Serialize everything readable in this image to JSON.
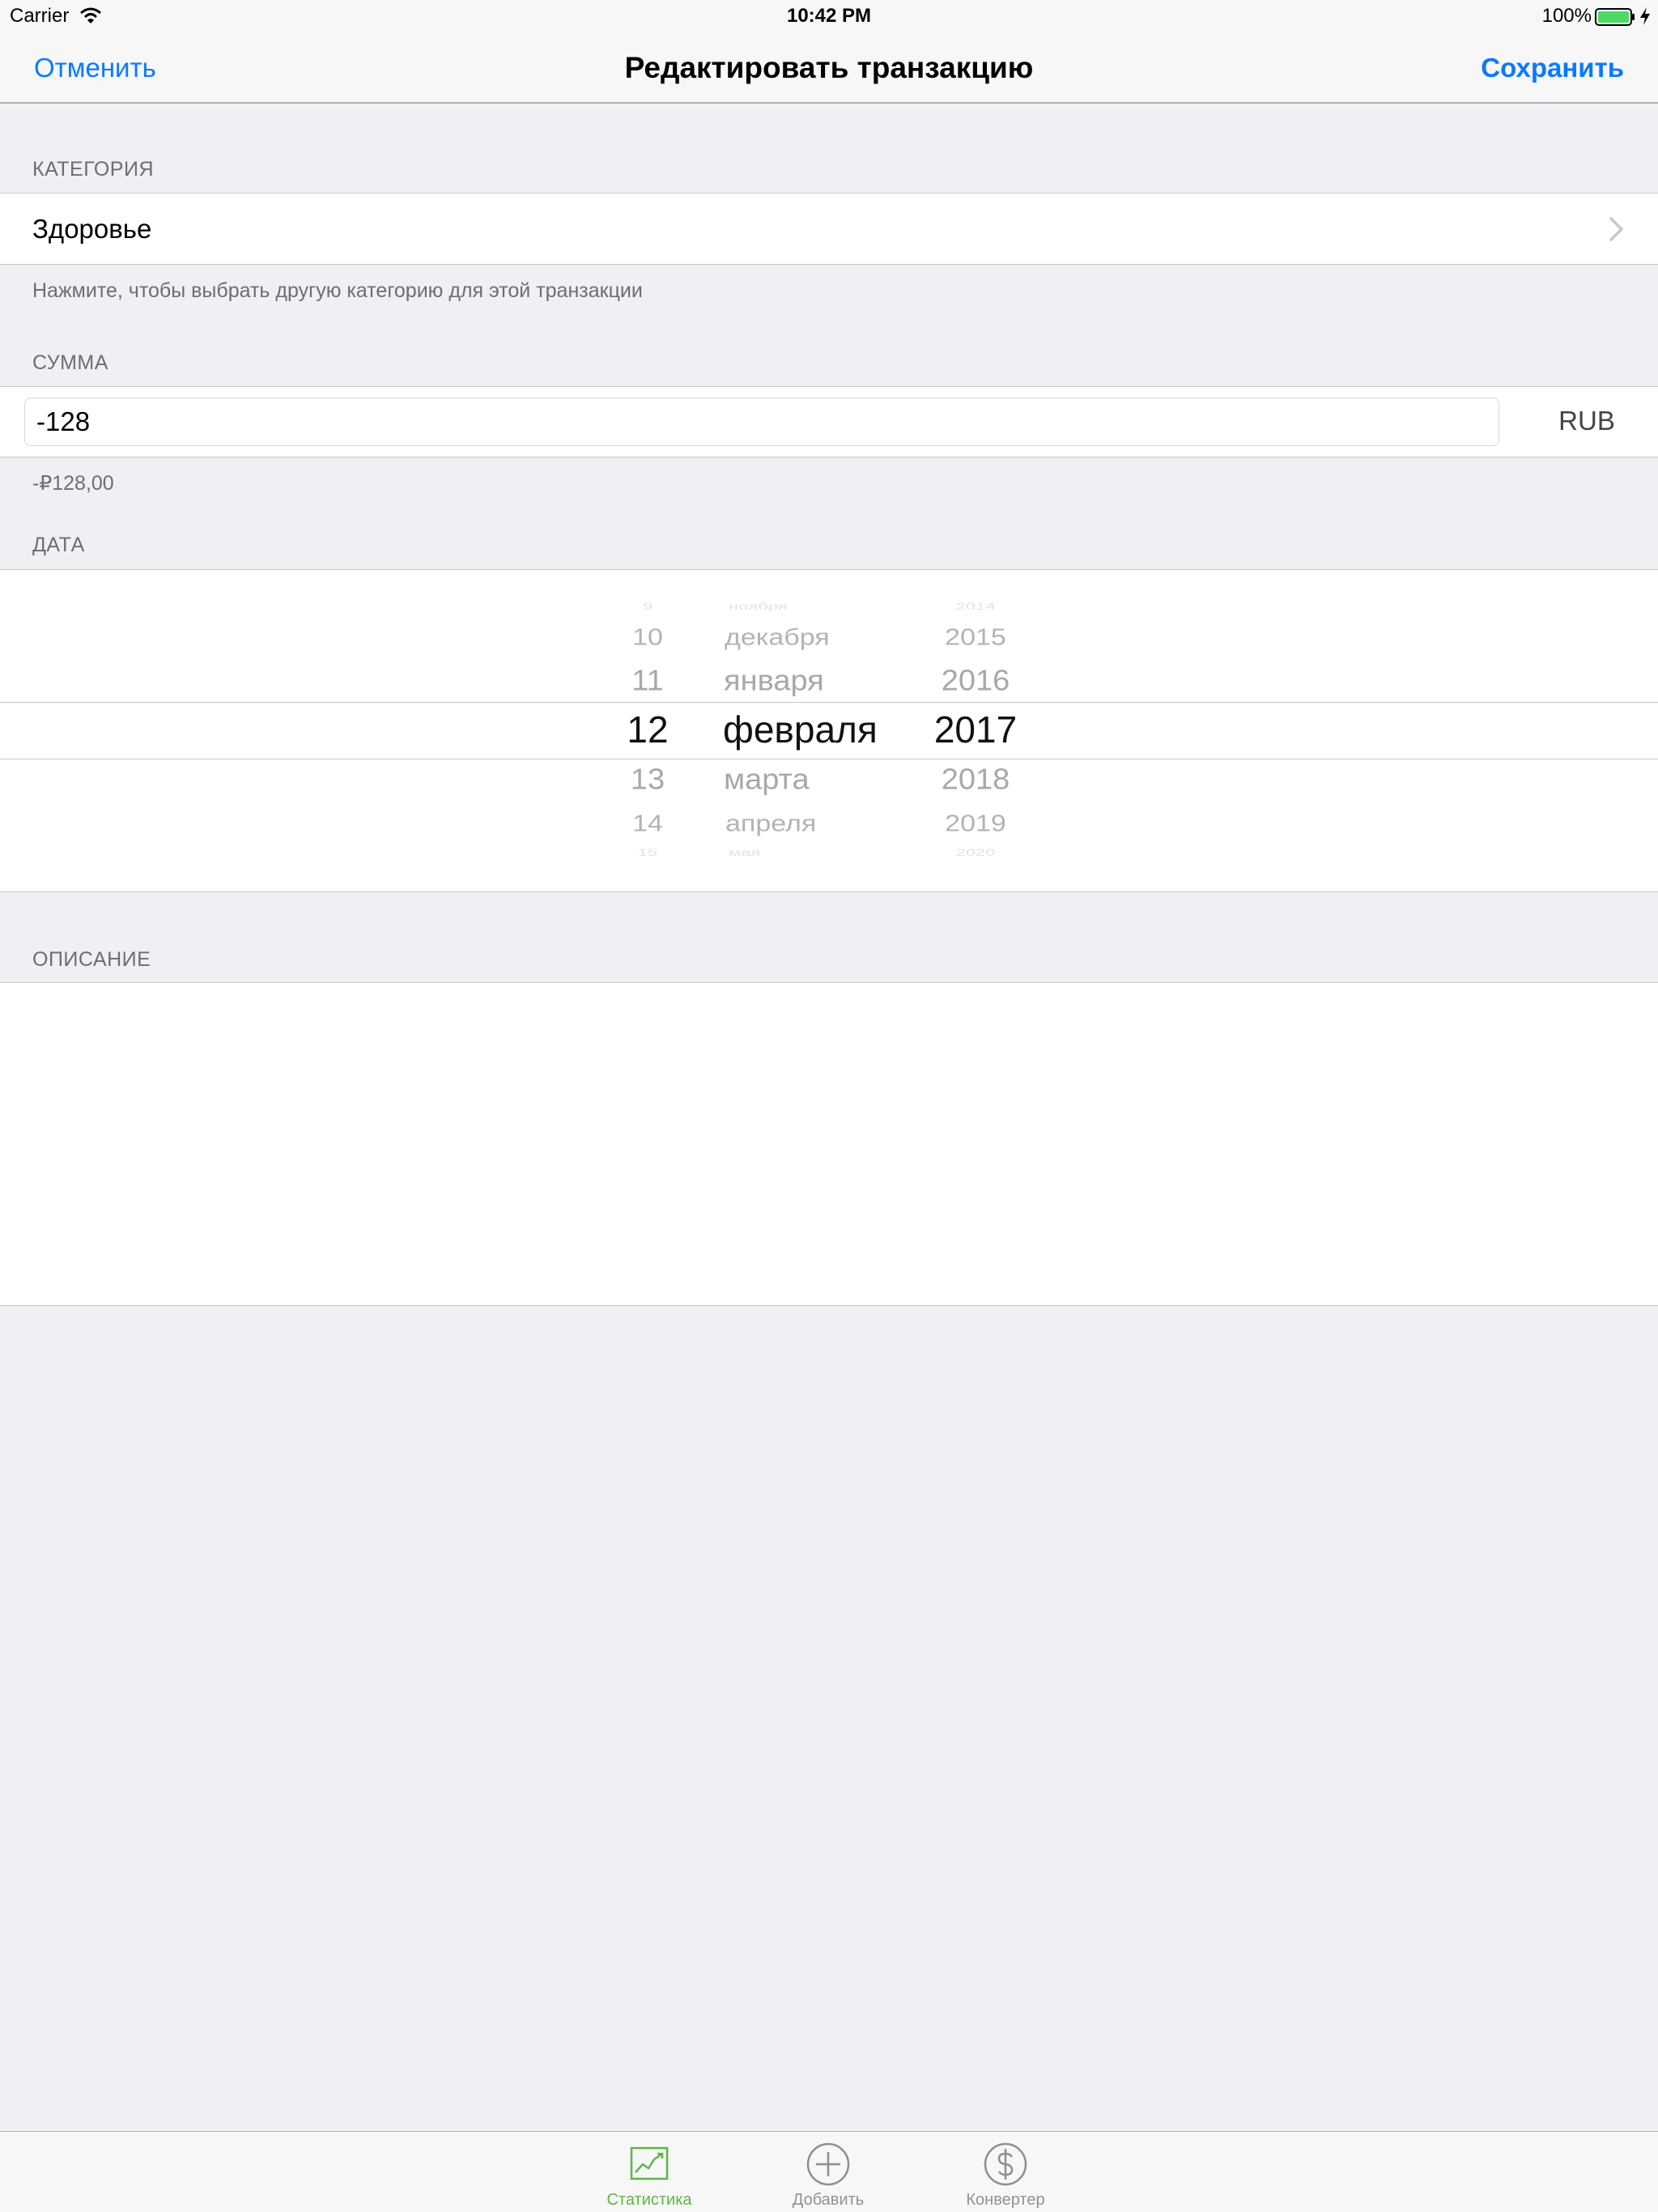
{
  "status_bar": {
    "carrier": "Carrier",
    "time": "10:42 PM",
    "battery": "100%"
  },
  "nav": {
    "cancel": "Отменить",
    "title": "Редактировать транзакцию",
    "save": "Сохранить"
  },
  "category": {
    "header": "КАТЕГОРИЯ",
    "value": "Здоровье",
    "footer": "Нажмите, чтобы выбрать другую категорию для этой транзакции"
  },
  "amount": {
    "header": "СУММА",
    "value": "-128",
    "currency": "RUB",
    "formatted": "-₽128,00"
  },
  "date": {
    "header": "ДАТА",
    "days": [
      "9",
      "10",
      "11",
      "12",
      "13",
      "14",
      "15"
    ],
    "months": [
      "ноября",
      "декабря",
      "января",
      "февраля",
      "марта",
      "апреля",
      "мая"
    ],
    "years": [
      "2014",
      "2015",
      "2016",
      "2017",
      "2018",
      "2019",
      "2020"
    ],
    "selected": {
      "day": "12",
      "month": "февраля",
      "year": "2017"
    }
  },
  "description": {
    "header": "ОПИСАНИЕ",
    "value": ""
  },
  "tabs": [
    {
      "label": "Статистика",
      "icon": "chart-icon",
      "active": true
    },
    {
      "label": "Добавить",
      "icon": "plus-circle-icon",
      "active": false
    },
    {
      "label": "Конвертер",
      "icon": "dollar-circle-icon",
      "active": false
    }
  ],
  "colors": {
    "accent": "#0a7aff",
    "tab_active": "#5cb646",
    "battery": "#4cd964"
  }
}
